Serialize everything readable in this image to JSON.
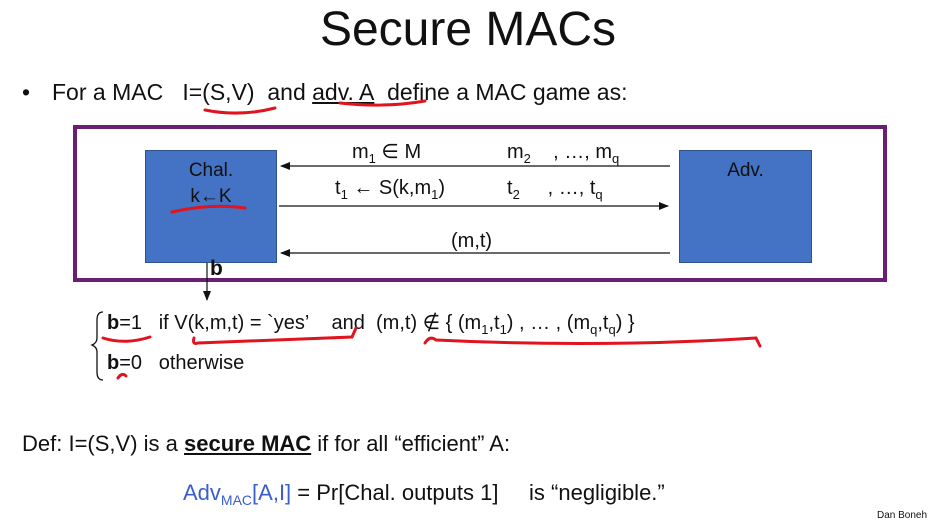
{
  "title": "Secure MACs",
  "bullet": {
    "symbol": "•",
    "text_1": "For a MAC",
    "mac": "I=(S,V)",
    "text_2": "and",
    "adv": "adv.  A",
    "text_3": "define a MAC game as:"
  },
  "challenger": {
    "label": "Chal.",
    "key": "k←K"
  },
  "adversary": {
    "label": "Adv."
  },
  "messages": {
    "m1": "m",
    "m1_sub": "1",
    "m1_in": " ∈ M",
    "m2": "m",
    "m2_sub": "2",
    "m_ellipsis": ", …, m",
    "mq_sub": "q",
    "t1_pre": "t",
    "t1_sub": "1",
    "t1_rest": " ← S(k,m",
    "t1_rest_sub": "1",
    "t1_close": ")",
    "t2": "t",
    "t2_sub": "2",
    "t_ellipsis": ", …, t",
    "tq_sub": "q",
    "mt": "(m,t)"
  },
  "b_label": "b",
  "conditions": {
    "line1": {
      "b": "b",
      "eq": "=1",
      "if": "if",
      "verify": "V(k,m,t) = `yes’",
      "and": "and",
      "set_open": "(m,t)  ∉  { (m",
      "s1": "1",
      "mid1": ",t",
      "s2": "1",
      "mid2": ") , … , (m",
      "s3": "q",
      "mid3": ",t",
      "s4": "q",
      "set_close": ") }"
    },
    "line2": {
      "b": "b",
      "eq": "=0",
      "otherwise": "otherwise"
    }
  },
  "definition": {
    "pre": "Def:  I=(S,V)  is a",
    "secure": "secure MAC",
    "post": "if for all “efficient”  A:"
  },
  "advantage": {
    "adv": "Adv",
    "sub": "MAC",
    "args": "[A,I]",
    "eq": " =  Pr[Chal. outputs 1]",
    "neg": "is “negligible.”"
  },
  "author": "Dan Boneh",
  "colors": {
    "frame": "#6a1e74",
    "box": "#4472c4",
    "annotation": "#e0141e",
    "adv_text": "#3a5fcd"
  }
}
